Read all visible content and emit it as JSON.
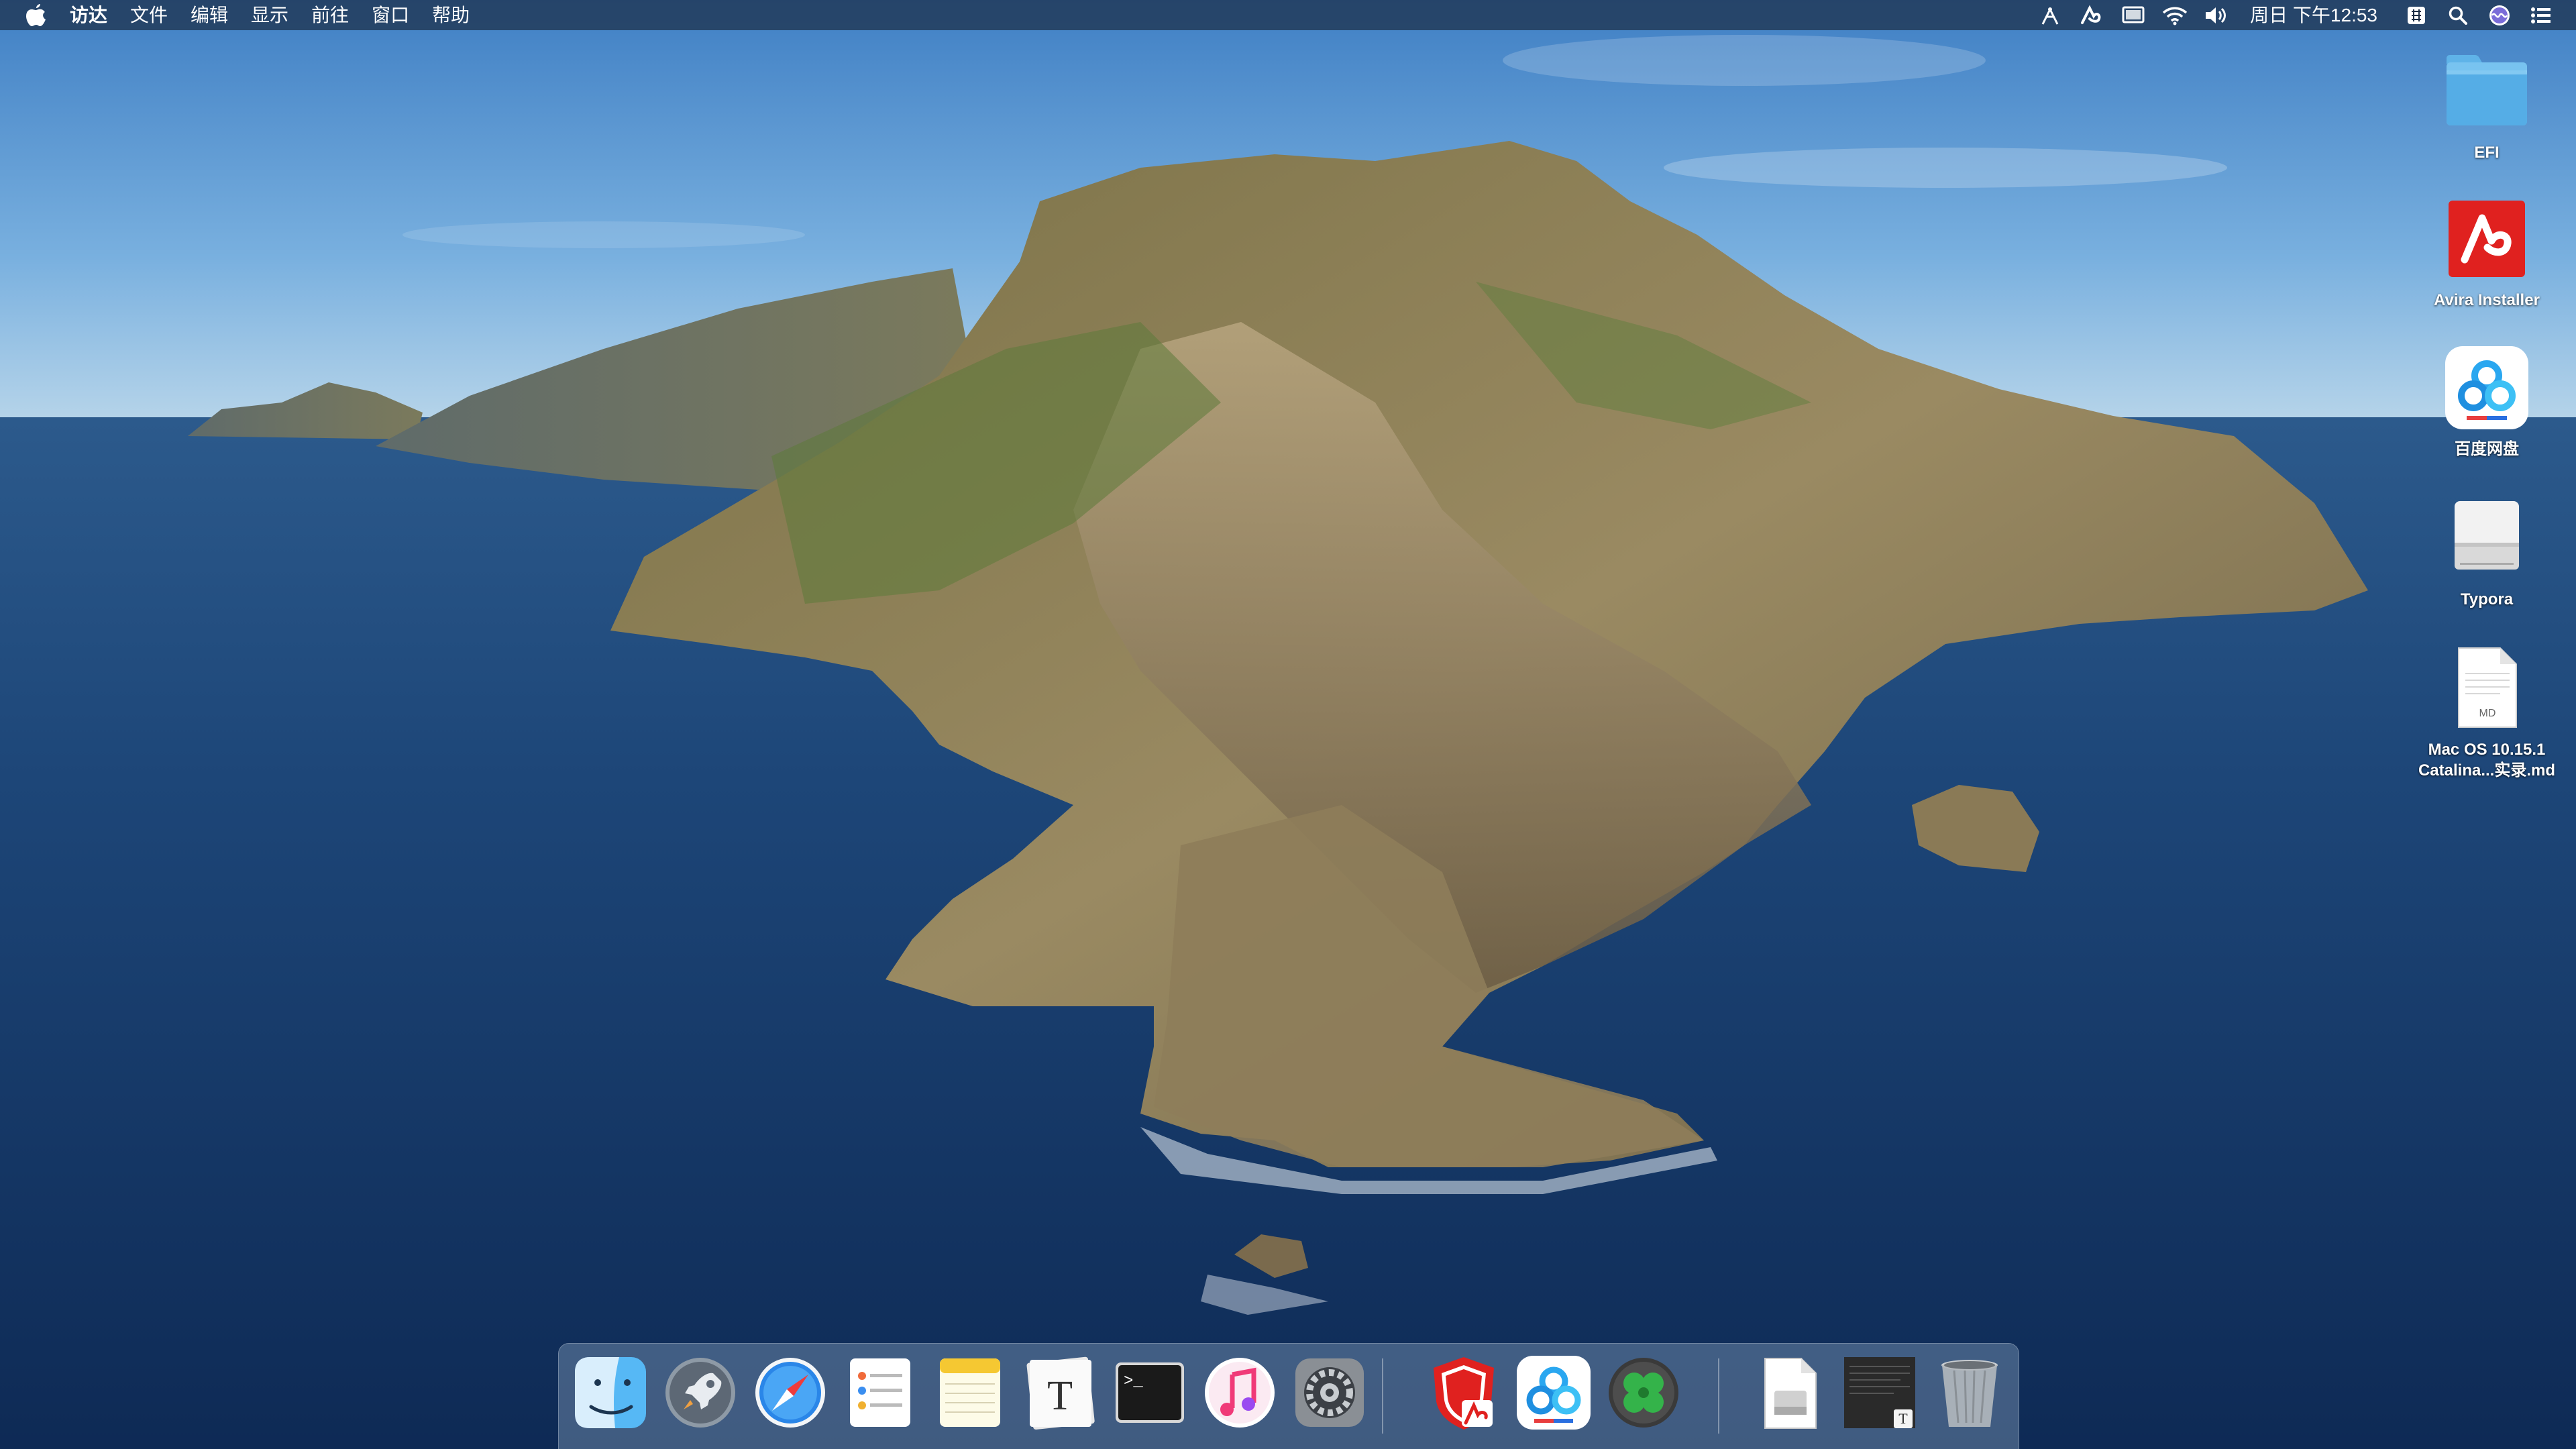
{
  "menubar": {
    "app_name": "访达",
    "items": [
      "文件",
      "编辑",
      "显示",
      "前往",
      "窗口",
      "帮助"
    ],
    "clock": "周日 下午12:53"
  },
  "desktop_icons": [
    {
      "label": "EFI",
      "icon": "folder-icon"
    },
    {
      "label": "Avira Installer",
      "icon": "avira-installer-icon"
    },
    {
      "label": "百度网盘",
      "icon": "baidu-netdisk-icon"
    },
    {
      "label": "Typora",
      "icon": "drive-icon"
    },
    {
      "label": "Mac OS 10.15.1 Catalina...实录.md",
      "label_line1": "Mac OS 10.15.1",
      "label_line2": "Catalina...实录.md",
      "icon": "markdown-file-icon",
      "badge": "MD"
    }
  ],
  "dock": {
    "apps": [
      {
        "name": "finder-icon",
        "running": true
      },
      {
        "name": "launchpad-icon",
        "running": false
      },
      {
        "name": "safari-icon",
        "running": true
      },
      {
        "name": "reminders-icon",
        "running": false
      },
      {
        "name": "notes-icon",
        "running": false
      },
      {
        "name": "typora-icon",
        "running": true,
        "glyph": "T"
      },
      {
        "name": "terminal-icon",
        "running": true,
        "glyph": ">_"
      },
      {
        "name": "itunes-icon",
        "running": false
      },
      {
        "name": "system-preferences-icon",
        "running": false
      },
      {
        "name": "avira-icon",
        "running": false
      },
      {
        "name": "baidu-netdisk-icon",
        "running": true
      },
      {
        "name": "clover-configurator-icon",
        "running": false
      },
      {
        "name": "drive-document-icon",
        "running": false
      },
      {
        "name": "typora-document-icon",
        "running": false
      },
      {
        "name": "trash-icon",
        "running": false
      }
    ]
  },
  "colors": {
    "menubar": "#1c2e46",
    "ocean_deep": "#173a68",
    "sky": "#6ea6d8",
    "avira_red": "#e0211f",
    "baidu_blue": "#2aa7f0"
  }
}
